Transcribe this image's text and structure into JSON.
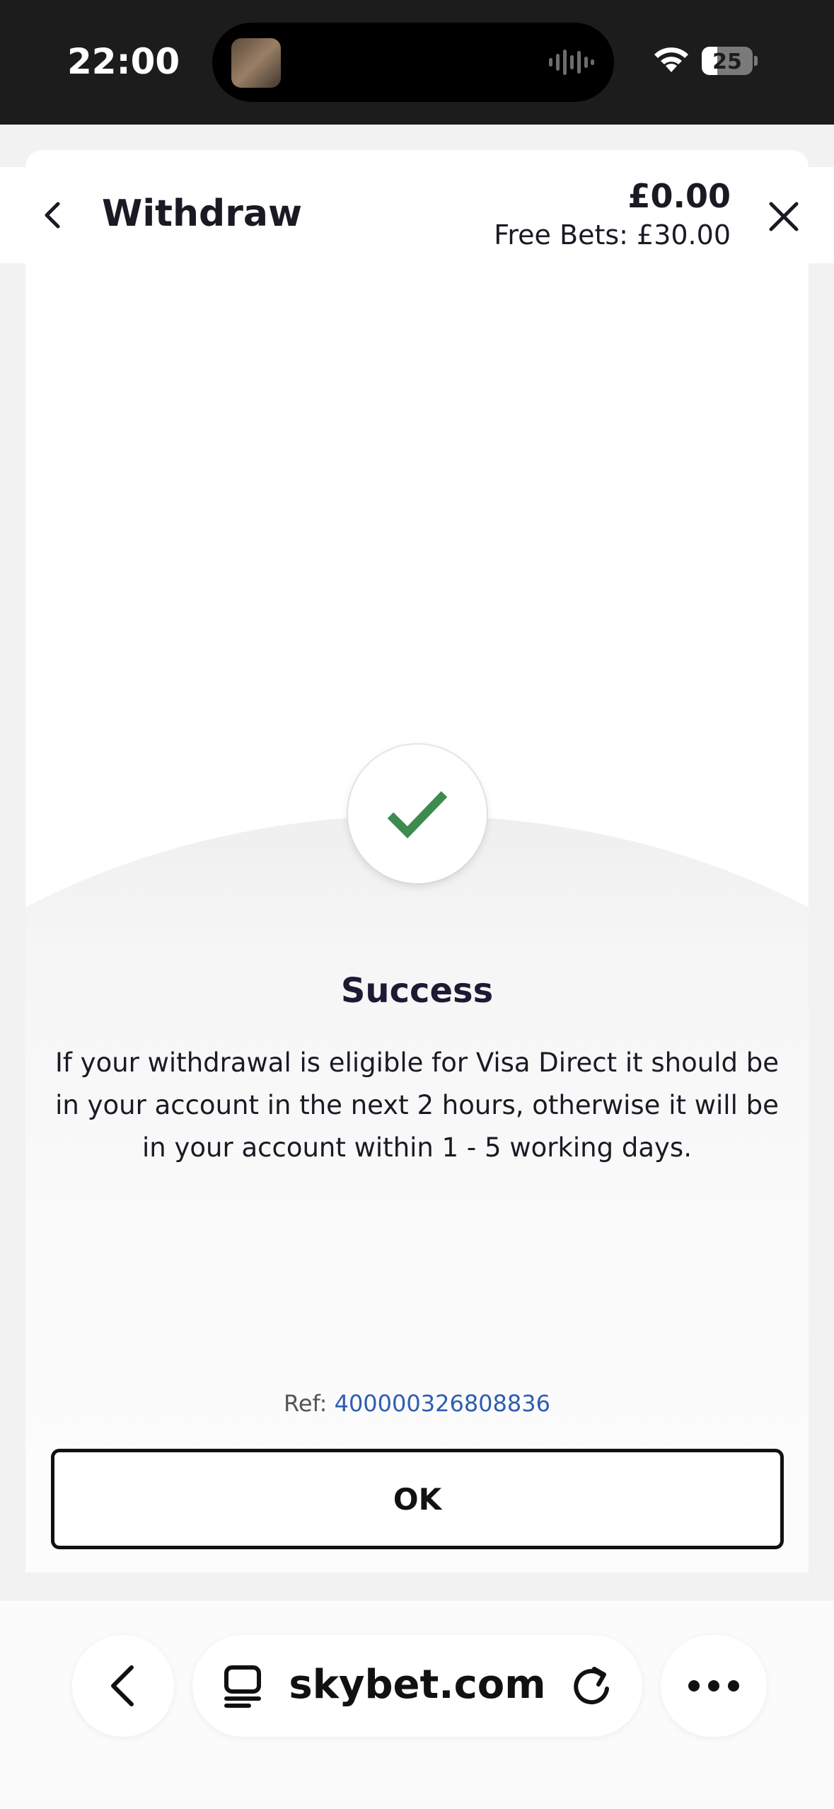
{
  "status_bar": {
    "time": "22:00",
    "battery": "25",
    "icons": [
      "wifi-icon",
      "battery-icon",
      "audio-wave-icon"
    ]
  },
  "header": {
    "title": "Withdraw",
    "balance": "£0.00",
    "free_bets": "Free Bets: £30.00",
    "icons": [
      "chevron-left-icon",
      "close-icon"
    ]
  },
  "result": {
    "icon": "checkmark-icon",
    "title": "Success",
    "message": "If your withdrawal is eligible for Visa Direct it should be in your account in the next 2 hours, otherwise it will be in your account within 1 - 5 working days.",
    "ref_label": "Ref:",
    "ref_value": "400000326808836",
    "ok_label": "OK"
  },
  "browser": {
    "url": "skybet.com",
    "icons": [
      "back-arrow-icon",
      "tabs-icon",
      "reload-icon",
      "more-icon"
    ]
  },
  "colors": {
    "success_green": "#3d8b4f",
    "ref_link": "#2e5db3",
    "title_text": "#1e1a33"
  }
}
